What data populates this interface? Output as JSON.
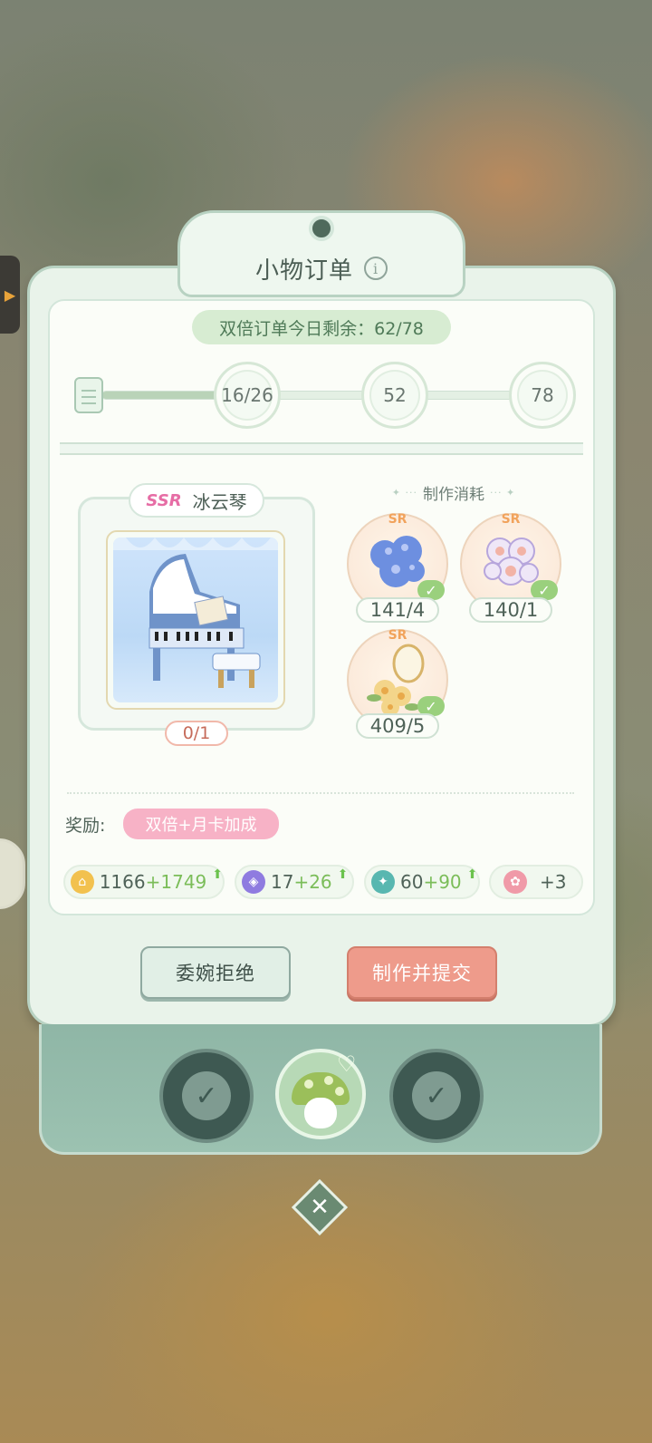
{
  "order": {
    "title": "小物订单",
    "info_icon_glyph": "i",
    "double_remaining_label": "双倍订单今日剩余：62/78",
    "progress_fraction": 0.27,
    "milestones": [
      "16/26",
      "52",
      "78"
    ]
  },
  "product": {
    "rarity": "SSR",
    "name": "冰云琴",
    "count": "0/1"
  },
  "materials": {
    "title": "制作消耗",
    "items": [
      {
        "rarity": "SR",
        "count": "141/4",
        "icon": "blue-hydrangea-icon",
        "fulfilled": true
      },
      {
        "rarity": "SR",
        "count": "140/1",
        "icon": "purple-bubble-flower-icon",
        "fulfilled": true
      },
      {
        "rarity": "SR",
        "count": "409/5",
        "icon": "yellow-flower-mirror-icon",
        "fulfilled": true
      }
    ]
  },
  "rewards": {
    "label": "奖励:",
    "bonus_tag": "双倍+月卡加成",
    "items": [
      {
        "icon": "coin-icon",
        "base": "1166",
        "bonus": "+1749",
        "color": "#f2c14e"
      },
      {
        "icon": "purple-gem-icon",
        "base": "17",
        "bonus": "+26",
        "color": "#8f7be0"
      },
      {
        "icon": "exp-badge-icon",
        "base": "60",
        "bonus": "+90",
        "color": "#58b7b0"
      },
      {
        "icon": "gift-icon",
        "base": "",
        "bonus": "+3",
        "color": "#f09aa8"
      }
    ]
  },
  "actions": {
    "decline_label": "委婉拒绝",
    "submit_label": "制作并提交"
  },
  "tray": {
    "slots": [
      "check-icon",
      "mushroom-avatar",
      "check-icon"
    ],
    "check_glyph": "✓",
    "close_glyph": "✕"
  },
  "colors": {
    "accent_green": "#7bbd59",
    "submit_red": "#ee9b8b",
    "ssr_pink": "#e66da5",
    "sr_orange": "#f1a35c"
  }
}
